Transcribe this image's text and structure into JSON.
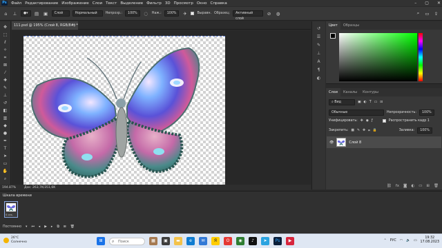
{
  "menubar": {
    "logo": "Ps",
    "items": [
      "Файл",
      "Редактирование",
      "Изображение",
      "Слои",
      "Текст",
      "Выделение",
      "Фильтр",
      "3D",
      "Просмотр",
      "Окно",
      "Справка"
    ],
    "window_controls": [
      "–",
      "▢",
      "✕"
    ]
  },
  "options": {
    "style_value": "Слой",
    "mode_value": "Нормальный",
    "opacity_label": "Непрозр.:",
    "opacity_value": "100%",
    "flow_label": "Наж.:",
    "flow_value": "100%",
    "align_label": "Выравн.",
    "sample_label": "Образец:",
    "sample_value": "Активный слой"
  },
  "document": {
    "tab_title": "111.psd @ 195% (Слой 8, RGB/8#) *",
    "close": "×"
  },
  "status": {
    "zoom": "194.87%",
    "doc_size": "Док: 263,7K/351,6K"
  },
  "timeline": {
    "title": "Шкала времени",
    "frame_time": "0 сек.",
    "loop_value": "Постоянно"
  },
  "color_panel": {
    "tabs": [
      "Цвет",
      "Образцы"
    ],
    "hue_color": "#00ff00",
    "fg_color": "#000000",
    "bg_color": "#f4cfcf"
  },
  "layers_panel": {
    "tabs": [
      "Слои",
      "Каналы",
      "Контуры"
    ],
    "filter_label": "Вид",
    "blend_mode": "Обычные",
    "opacity_label": "Непрозрачность:",
    "opacity_value": "100%",
    "unify_label": "Унифицировать:",
    "propagate_label": "Распространить кадр 1",
    "lock_label": "Закрепить:",
    "fill_label": "Заливка:",
    "fill_value": "100%",
    "layer_name": "Слой 8"
  },
  "taskbar": {
    "temperature": "26°C",
    "weather": "Солнечно",
    "search_placeholder": "Поиск",
    "language": "РУС",
    "time": "19:32",
    "date": "17.08.2023"
  }
}
